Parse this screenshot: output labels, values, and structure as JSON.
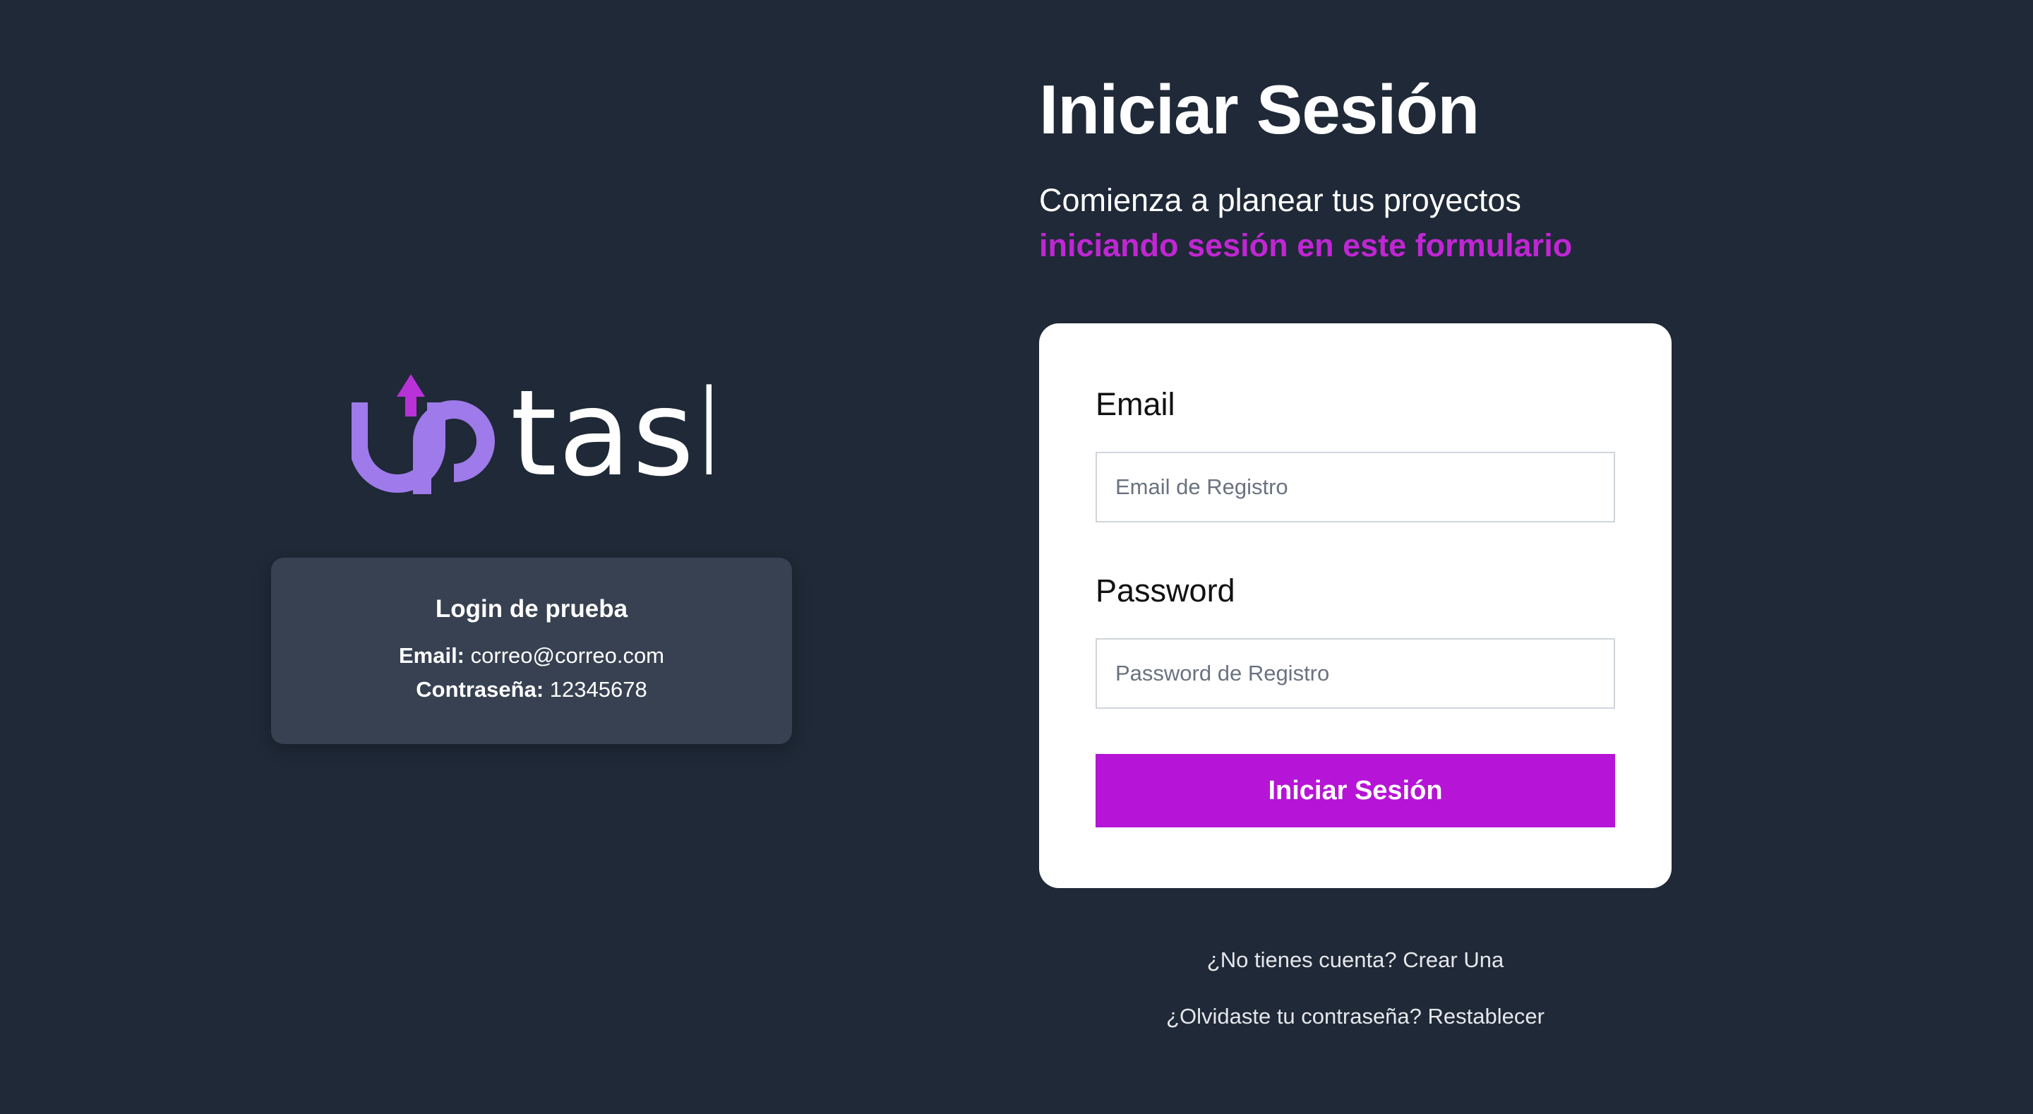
{
  "brand": {
    "logo_text": "uptask",
    "colors": {
      "logo_purple": "#9f7aea",
      "logo_arrow": "#b832d8"
    }
  },
  "demo": {
    "title": "Login de prueba",
    "email_label": "Email:",
    "email_value": "correo@correo.com",
    "password_label": "Contraseña:",
    "password_value": "12345678"
  },
  "header": {
    "title": "Iniciar Sesión",
    "subtitle": "Comienza a planear tus proyectos",
    "subtitle_accent": "iniciando sesión en este formulario"
  },
  "form": {
    "email_label": "Email",
    "email_placeholder": "Email de Registro",
    "password_label": "Password",
    "password_placeholder": "Password de Registro",
    "submit_label": "Iniciar Sesión"
  },
  "links": {
    "register": "¿No tienes cuenta? Crear Una",
    "forgot": "¿Olvidaste tu contraseña? Restablecer"
  },
  "colors": {
    "background": "#1f2937",
    "card_dark": "#374151",
    "accent": "#c026d3",
    "button": "#b614d6"
  }
}
